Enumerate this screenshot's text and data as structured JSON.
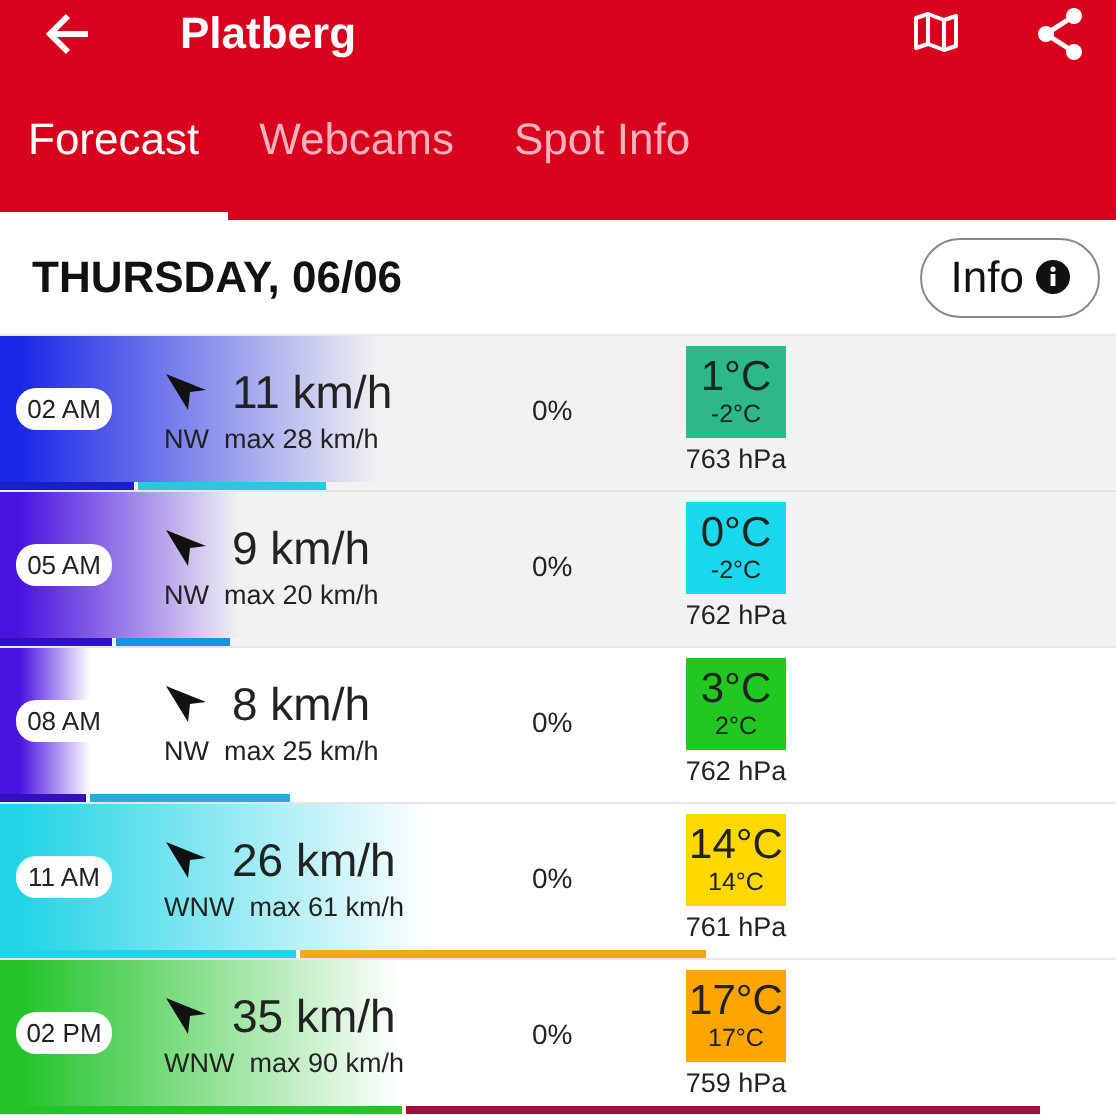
{
  "header": {
    "title": "Platberg"
  },
  "tabs": [
    {
      "label": "Forecast",
      "selected": true
    },
    {
      "label": "Webcams",
      "selected": false
    },
    {
      "label": "Spot Info",
      "selected": false
    }
  ],
  "day": {
    "title": "THURSDAY, 06/06",
    "info_button": "Info"
  },
  "rows": [
    {
      "time": "02 AM",
      "wind": "11 km/h",
      "detail": "NW  max 28 km/h",
      "rain": "0%",
      "temp": "1°C",
      "feels": "-2°C",
      "pressure": "763 hPa",
      "shaded": true,
      "color": "#1a28e6",
      "temp_tile": {
        "color": "#2db88a"
      },
      "wind_bar": {
        "level": 0.12,
        "color": "#1a1fc8"
      },
      "gust_bar": {
        "level": 0.292,
        "color": "#22ccdc"
      }
    },
    {
      "time": "05 AM",
      "wind": "9 km/h",
      "detail": "NW  max 20 km/h",
      "rain": "0%",
      "temp": "0°C",
      "feels": "-2°C",
      "pressure": "762 hPa",
      "shaded": true,
      "color": "#4a14e0",
      "temp_tile": {
        "color": "#18d8ec"
      },
      "wind_bar": {
        "level": 0.1,
        "color": "#3010c0"
      },
      "gust_bar": {
        "level": 0.206,
        "color": "#2090e0"
      }
    },
    {
      "time": "08 AM",
      "wind": "8 km/h",
      "detail": "NW  max 25 km/h",
      "rain": "0%",
      "temp": "3°C",
      "feels": "2°C",
      "pressure": "762 hPa",
      "shaded": false,
      "color": "#4a14e0",
      "temp_tile": {
        "color": "#22c822"
      },
      "wind_bar": {
        "level": 0.077,
        "color": "#3010c0"
      },
      "gust_bar": {
        "level": 0.26,
        "color": "#20b0e0"
      }
    },
    {
      "time": "11 AM",
      "wind": "26 km/h",
      "detail": "WNW  max 61 km/h",
      "rain": "0%",
      "temp": "14°C",
      "feels": "14°C",
      "pressure": "761 hPa",
      "shaded": false,
      "color": "#22d4e6",
      "temp_tile": {
        "color": "#ffd800"
      },
      "wind_bar": {
        "level": 0.265,
        "color": "#22d4e6"
      },
      "gust_bar": {
        "level": 0.633,
        "color": "#f0a820"
      }
    },
    {
      "time": "02 PM",
      "wind": "35 km/h",
      "detail": "WNW  max 90 km/h",
      "rain": "0%",
      "temp": "17°C",
      "feels": "17°C",
      "pressure": "759 hPa",
      "shaded": false,
      "color": "#22c42a",
      "temp_tile": {
        "color": "#ffa500"
      },
      "wind_bar": {
        "level": 0.36,
        "color": "#22c42a"
      },
      "gust_bar": {
        "level": 0.932,
        "color": "#a0103a"
      }
    }
  ]
}
